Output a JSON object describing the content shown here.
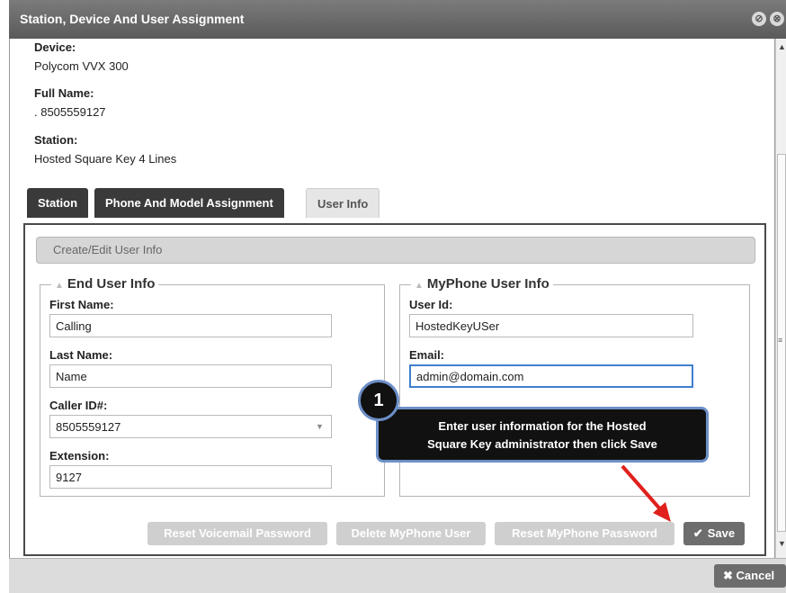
{
  "dialog": {
    "title": "Station, Device And User Assignment",
    "close_glyph": "⊗",
    "minimize_glyph": "⊘"
  },
  "info": {
    "device_label": "Device:",
    "device_value": "Polycom VVX 300",
    "fullname_label": "Full Name:",
    "fullname_value": ". 8505559127",
    "station_label": "Station:",
    "station_value": "Hosted Square Key 4 Lines"
  },
  "tabs": [
    {
      "label": "Station",
      "active": false
    },
    {
      "label": "Phone And Model Assignment",
      "active": false
    },
    {
      "label": "User Info",
      "active": true
    }
  ],
  "section_header": "Create/Edit User Info",
  "end_user": {
    "legend": "End User Info",
    "first_name_label": "First Name:",
    "first_name_value": "Calling",
    "last_name_label": "Last Name:",
    "last_name_value": "Name",
    "caller_id_label": "Caller ID#:",
    "caller_id_value": "8505559127",
    "extension_label": "Extension:",
    "extension_value": "9127"
  },
  "myphone": {
    "legend": "MyPhone User Info",
    "user_id_label": "User Id:",
    "user_id_value": "HostedKeyUSer",
    "email_label": "Email:",
    "email_value": "admin@domain.com"
  },
  "buttons": {
    "reset_voicemail": "Reset Voicemail Password",
    "delete_myphone": "Delete MyPhone User",
    "reset_myphone": "Reset MyPhone Password",
    "save": "Save",
    "cancel": "Cancel"
  },
  "callout": {
    "number": "1",
    "line1": "Enter user information for the Hosted",
    "line2": "Square Key administrator then click Save"
  },
  "colors": {
    "accent_blue": "#3f7fd0",
    "callout_border": "#6c8fc7",
    "arrow_red": "#e0201c"
  }
}
